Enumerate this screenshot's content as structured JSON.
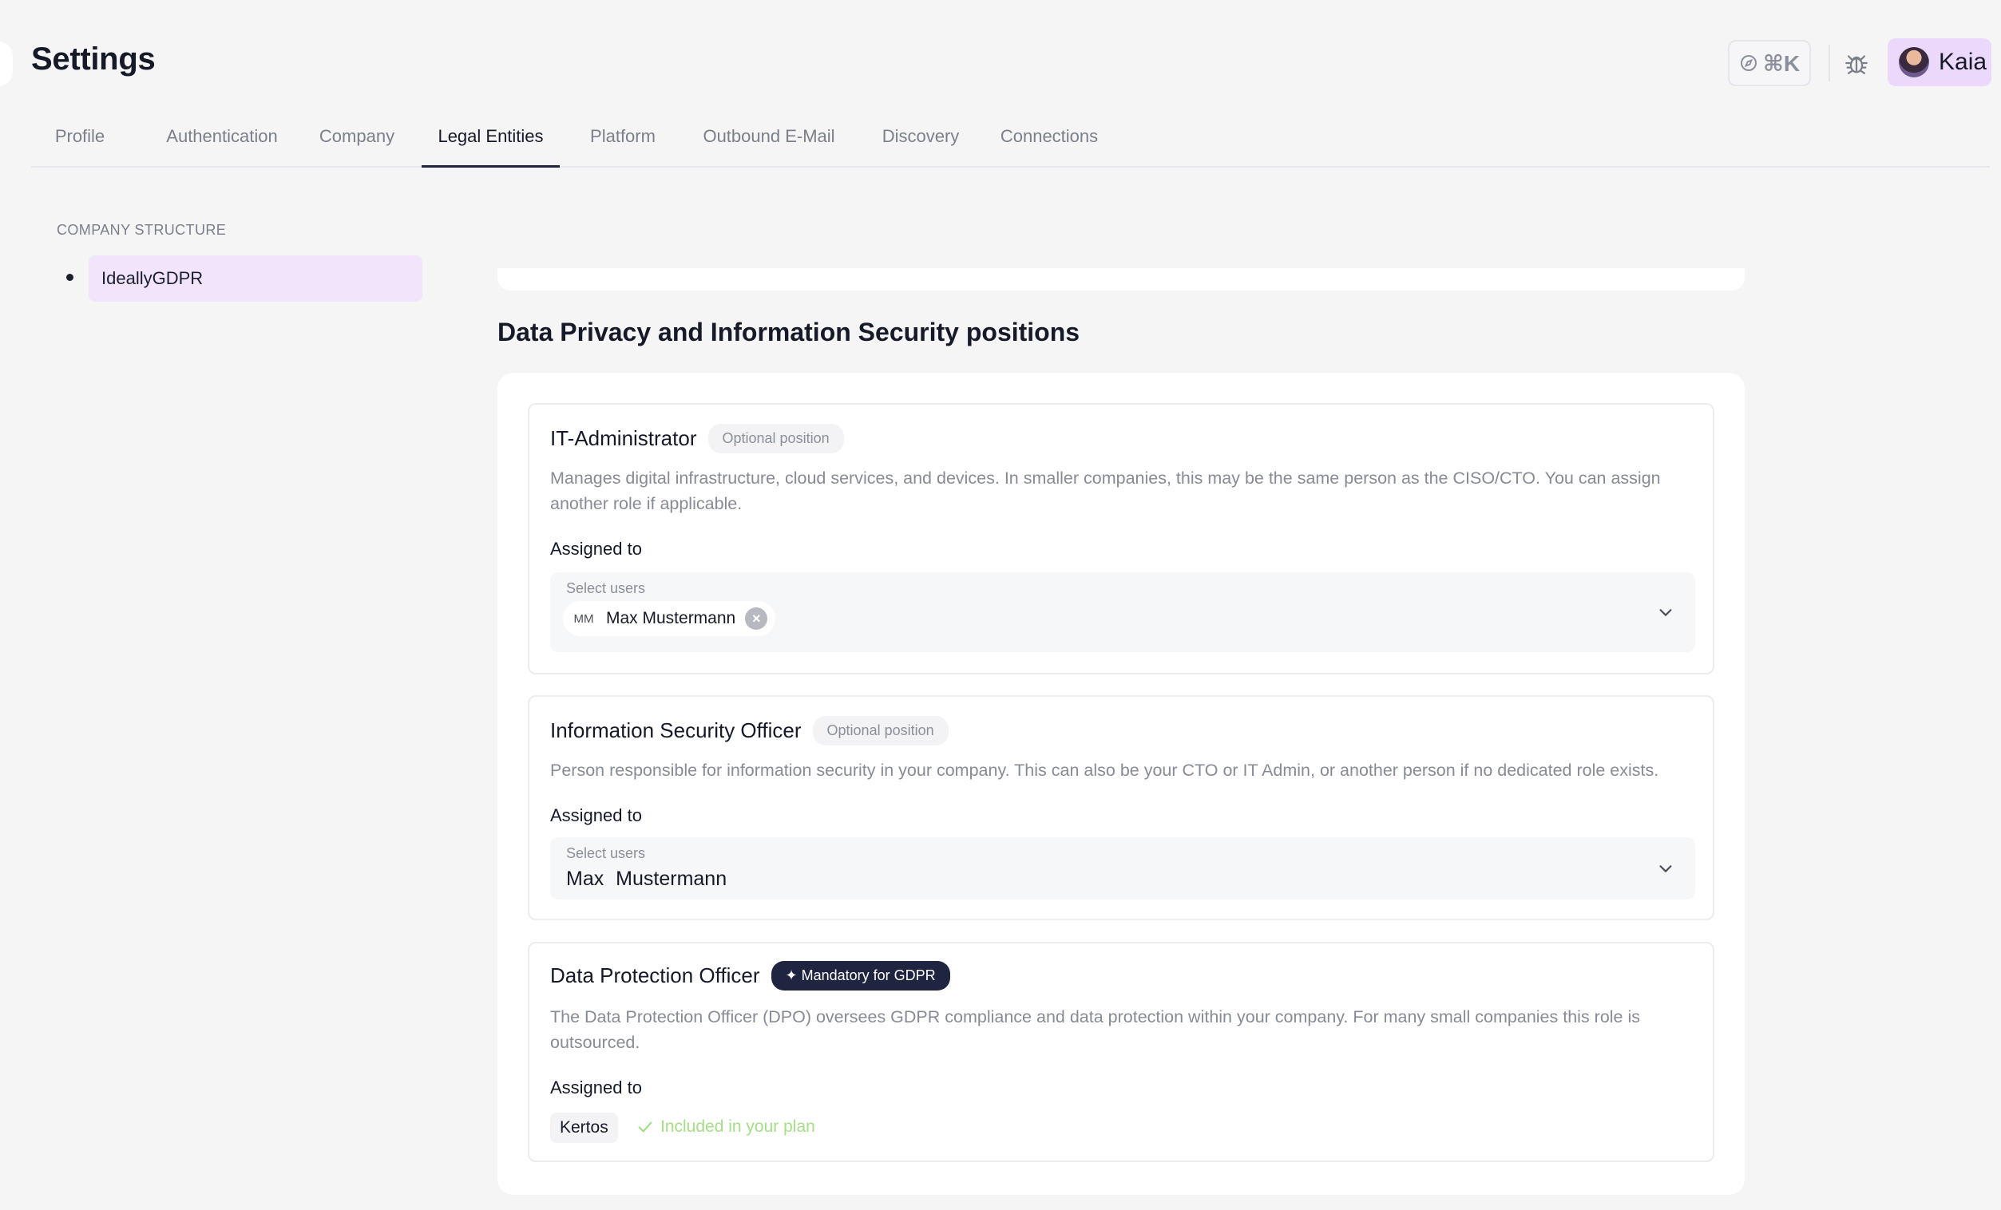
{
  "header": {
    "title": "Settings",
    "command_shortcut": "⌘K",
    "user_name": "Kaia"
  },
  "tabs": [
    {
      "label": "Profile",
      "active": false
    },
    {
      "label": "Authentication",
      "active": false
    },
    {
      "label": "Company",
      "active": false
    },
    {
      "label": "Legal Entities",
      "active": true
    },
    {
      "label": "Platform",
      "active": false
    },
    {
      "label": "Outbound E-Mail",
      "active": false
    },
    {
      "label": "Discovery",
      "active": false
    },
    {
      "label": "Connections",
      "active": false
    }
  ],
  "sidebar": {
    "section_label": "COMPANY STRUCTURE",
    "items": [
      {
        "label": "IdeallyGDPR",
        "selected": true
      }
    ]
  },
  "main": {
    "section_title": "Data Privacy and Information Security positions",
    "positions": [
      {
        "name": "IT-Administrator",
        "badge": "Optional position",
        "description": "Manages digital infrastructure, cloud services, and devices. In smaller companies, this may be the same person as the CISO/CTO. You can assign another role if applicable.",
        "assigned_label": "Assigned to",
        "select_label": "Select users",
        "selected_user": {
          "initials": "MM",
          "name": "Max Mustermann"
        }
      },
      {
        "name": "Information Security Officer",
        "badge": "Optional position",
        "description": "Person responsible for information security in your company. This can also be your CTO or IT Admin, or another person if no dedicated role exists.",
        "assigned_label": "Assigned to",
        "select_label": "Select users",
        "selected_value": "Max Mustermann"
      },
      {
        "name": "Data Protection Officer",
        "badge": "✦ Mandatory for GDPR",
        "description": "The Data Protection Officer (DPO) oversees GDPR compliance and data protection within your company. For many small companies this role is outsourced.",
        "assigned_label": "Assigned to",
        "assignee_tag": "Kertos",
        "included_text": "Included in your plan"
      }
    ]
  },
  "colors": {
    "accent_dark": "#1f2540",
    "user_chip_bg": "#ecd8fb",
    "selected_sidebar_bg": "#f1e4fb",
    "included_green": "#a6dd88"
  },
  "icons": [
    "compass-icon",
    "bug-icon",
    "chevron-down-icon",
    "close-icon",
    "check-icon"
  ]
}
